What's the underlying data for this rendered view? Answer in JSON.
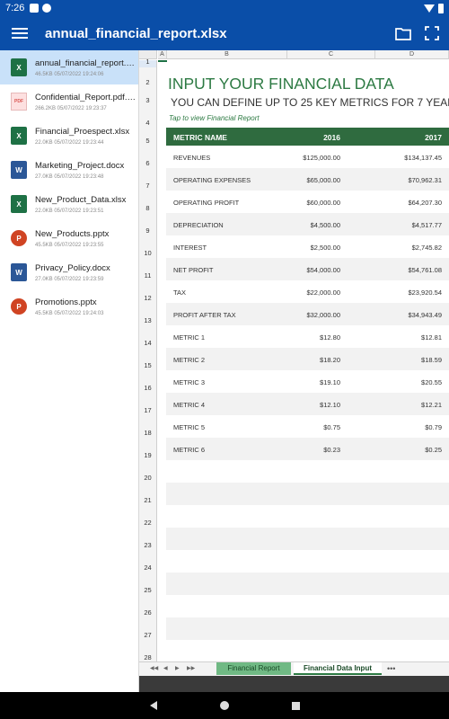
{
  "status": {
    "time": "7:26"
  },
  "appbar": {
    "title": "annual_financial_report.xlsx"
  },
  "files": [
    {
      "name": "annual_financial_report.xlsx",
      "meta": "46.5KB 05/07/2022 19:24:06",
      "type": "xlsx",
      "badge": "X",
      "selected": true
    },
    {
      "name": "Confidential_Report.pdf.slsx",
      "meta": "266.2KB 05/07/2022 19:23:37",
      "type": "pdf",
      "badge": "PDF",
      "selected": false
    },
    {
      "name": "Financial_Proespect.xlsx",
      "meta": "22.0KB 05/07/2022 19:23:44",
      "type": "xlsx",
      "badge": "X",
      "selected": false
    },
    {
      "name": "Marketing_Project.docx",
      "meta": "27.0KB 05/07/2022 19:23:48",
      "type": "docx",
      "badge": "W",
      "selected": false
    },
    {
      "name": "New_Product_Data.xlsx",
      "meta": "22.0KB 05/07/2022 19:23:51",
      "type": "xlsx",
      "badge": "X",
      "selected": false
    },
    {
      "name": "New_Products.pptx",
      "meta": "45.5KB 05/07/2022 19:23:55",
      "type": "pptx",
      "badge": "P",
      "selected": false
    },
    {
      "name": "Privacy_Policy.docx",
      "meta": "27.0KB 05/07/2022 19:23:59",
      "type": "docx",
      "badge": "W",
      "selected": false
    },
    {
      "name": "Promotions.pptx",
      "meta": "45.5KB 05/07/2022 19:24:03",
      "type": "pptx",
      "badge": "P",
      "selected": false
    }
  ],
  "grid": {
    "columns": [
      "A",
      "B",
      "C",
      "D"
    ],
    "rows": [
      "1",
      "2",
      "3",
      "4",
      "5",
      "6",
      "7",
      "8",
      "9",
      "10",
      "11",
      "12",
      "13",
      "14",
      "15",
      "16",
      "17",
      "18",
      "19",
      "20",
      "21",
      "22",
      "23",
      "24",
      "25",
      "26",
      "27",
      "28"
    ]
  },
  "sheet": {
    "title": "INPUT YOUR FINANCIAL DATA",
    "subtitle": "YOU CAN DEFINE UP TO 25 KEY METRICS FOR 7 YEARS",
    "link": "Tap to view Financial Report",
    "headers": {
      "name": "METRIC NAME",
      "y1": "2016",
      "y2": "2017"
    },
    "rows": [
      {
        "name": "REVENUES",
        "v1": "$125,000.00",
        "v2": "$134,137.45"
      },
      {
        "name": "OPERATING EXPENSES",
        "v1": "$65,000.00",
        "v2": "$70,962.31"
      },
      {
        "name": "OPERATING PROFIT",
        "v1": "$60,000.00",
        "v2": "$64,207.30"
      },
      {
        "name": "DEPRECIATION",
        "v1": "$4,500.00",
        "v2": "$4,517.77"
      },
      {
        "name": "INTEREST",
        "v1": "$2,500.00",
        "v2": "$2,745.82"
      },
      {
        "name": "NET PROFIT",
        "v1": "$54,000.00",
        "v2": "$54,761.08"
      },
      {
        "name": "TAX",
        "v1": "$22,000.00",
        "v2": "$23,920.54"
      },
      {
        "name": "PROFIT AFTER TAX",
        "v1": "$32,000.00",
        "v2": "$34,943.49"
      },
      {
        "name": "METRIC 1",
        "v1": "$12.80",
        "v2": "$12.81"
      },
      {
        "name": "METRIC 2",
        "v1": "$18.20",
        "v2": "$18.59"
      },
      {
        "name": "METRIC 3",
        "v1": "$19.10",
        "v2": "$20.55"
      },
      {
        "name": "METRIC 4",
        "v1": "$12.10",
        "v2": "$12.21"
      },
      {
        "name": "METRIC 5",
        "v1": "$0.75",
        "v2": "$0.79"
      },
      {
        "name": "METRIC 6",
        "v1": "$0.23",
        "v2": "$0.25"
      },
      {
        "name": "",
        "v1": "",
        "v2": ""
      },
      {
        "name": "",
        "v1": "",
        "v2": ""
      },
      {
        "name": "",
        "v1": "",
        "v2": ""
      },
      {
        "name": "",
        "v1": "",
        "v2": ""
      },
      {
        "name": "",
        "v1": "",
        "v2": ""
      },
      {
        "name": "",
        "v1": "",
        "v2": ""
      },
      {
        "name": "",
        "v1": "",
        "v2": ""
      },
      {
        "name": "",
        "v1": "",
        "v2": ""
      },
      {
        "name": "",
        "v1": "",
        "v2": ""
      }
    ]
  },
  "tabs": [
    {
      "label": "Financial Report",
      "active": false
    },
    {
      "label": "Financial Data Input",
      "active": true
    }
  ],
  "tabbar": {
    "more": "•••",
    "nav": [
      "◀◀",
      "◀",
      "▶",
      "▶▶"
    ]
  },
  "colors": {
    "brand": "#0a4ea8",
    "sheet_green": "#2f6b3f",
    "tab_green": "#70b984"
  },
  "icons": {
    "menu": "hamburger-menu-icon",
    "folder": "folder-icon",
    "fullscreen": "fullscreen-icon",
    "nav_back": "back-triangle-icon",
    "nav_home": "home-circle-icon",
    "nav_recent": "recents-square-icon"
  }
}
